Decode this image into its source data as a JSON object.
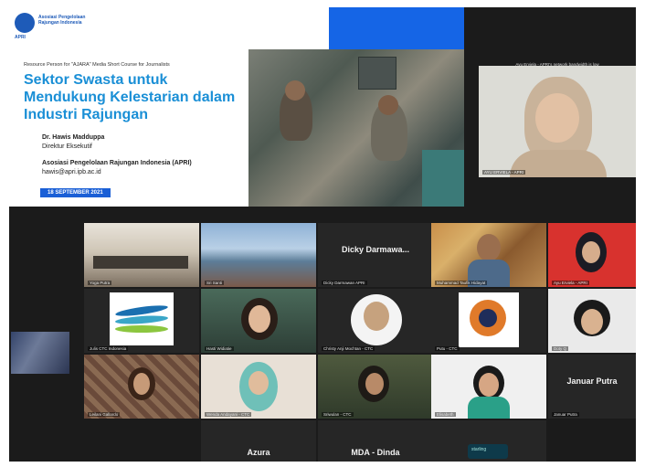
{
  "slide": {
    "logo_text": "Asosiasi Pengelolaan Rajungan Indonesia",
    "logo_abbr": "APRI",
    "subtitle": "Resource Person for \"AJARA\" Media Short Course for Journalists",
    "title": "Sektor Swasta untuk Mendukung Kelestarian dalam Industri Rajungan",
    "presenter_name": "Dr. Hawis Madduppa",
    "presenter_role": "Direktur Eksekutif",
    "org": "Asosiasi Pengelolaan Rajungan Indonesia (APRI)",
    "email": "hawis@apri.ipb.ac.id",
    "date": "18 SEPTEMBER 2021"
  },
  "speaker": {
    "status": "Ayu Erviela - APRI's network bandwidth is low",
    "name": "AYU ERVIELA - APRI"
  },
  "tiles": [
    {
      "label": "Yoga Putra",
      "bigname": ""
    },
    {
      "label": "Sri Santi",
      "bigname": ""
    },
    {
      "label": "Dicky Darmawan APRI",
      "bigname": "Dicky Darmawa..."
    },
    {
      "label": "Muhammad Taufik Hidayat",
      "bigname": ""
    },
    {
      "label": "Ayu Erviela - APRI",
      "bigname": ""
    },
    {
      "label": "Julis CTC Indonesia",
      "bigname": ""
    },
    {
      "label": "Hasti Widiatie",
      "bigname": ""
    },
    {
      "label": "Christy Anji Mochtan - CTC",
      "bigname": ""
    },
    {
      "label": "Putu - CTC",
      "bigname": ""
    },
    {
      "label": "Doty Q",
      "bigname": ""
    },
    {
      "label": "Leilani Gallardo",
      "bigname": ""
    },
    {
      "label": "Wenda Andayani - CTC",
      "bigname": ""
    },
    {
      "label": "Sriwulan - CTC",
      "bigname": ""
    },
    {
      "label": "Elisabeth",
      "bigname": ""
    },
    {
      "label": "Januar Putra",
      "bigname": "Januar Putra"
    },
    {
      "label": "",
      "bigname": "Azura"
    },
    {
      "label": "",
      "bigname": "MDA - Dinda"
    },
    {
      "label": "starling",
      "bigname": ""
    }
  ]
}
